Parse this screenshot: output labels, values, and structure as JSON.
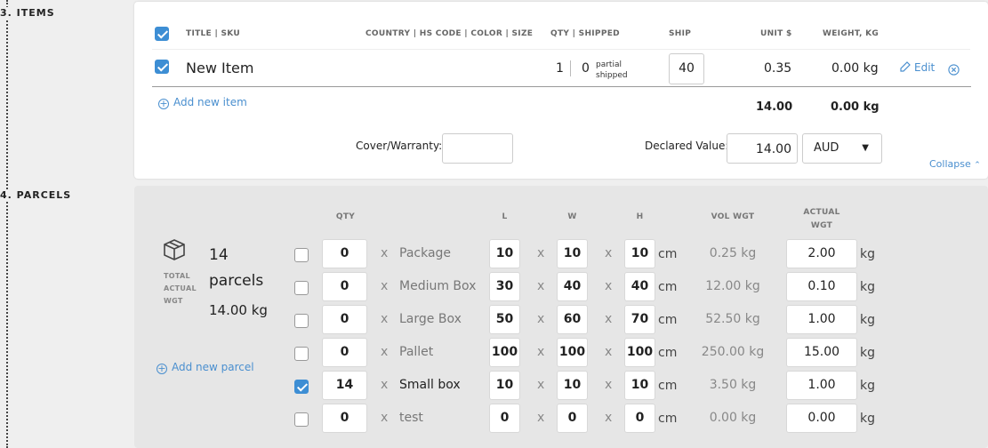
{
  "sections": {
    "items_label": "3. ITEMS",
    "parcels_label": "4. PARCELS"
  },
  "items": {
    "headers": {
      "title_sku": "TITLE | SKU",
      "country": "COUNTRY | HS CODE | COLOR | SIZE",
      "qty_shipped": "QTY |  SHIPPED",
      "ship": "SHIP",
      "unit": "UNIT $",
      "weight": "WEIGHT, KG"
    },
    "row": {
      "title": "New Item",
      "qty": "1",
      "shipped": "0",
      "status_line1": "partial",
      "status_line2": "shipped",
      "ship_value": "40",
      "unit": "0.35",
      "weight": "0.00 kg",
      "edit_label": "Edit"
    },
    "add_item_label": "Add new item",
    "totals": {
      "unit": "14.00",
      "weight": "0.00 kg"
    },
    "cover_label": "Cover/Warranty:",
    "cover_value": "",
    "declared_label": "Declared Value:",
    "declared_value": "14.00",
    "currency": "AUD",
    "collapse_label": "Collapse"
  },
  "parcels": {
    "headers": {
      "qty": "QTY",
      "l": "L",
      "w": "W",
      "h": "H",
      "vol": "VOL WGT",
      "actual_line1": "ACTUAL",
      "actual_line2": "WGT"
    },
    "summary": {
      "count": "14",
      "count_unit": "parcels",
      "total_weight": "14.00 kg",
      "label_line1": "TOTAL",
      "label_line2": "ACTUAL",
      "label_line3": "WGT"
    },
    "add_parcel_label": "Add new parcel",
    "x_symbol": "x",
    "dim_unit": "cm",
    "weight_unit": "kg",
    "rows": [
      {
        "checked": false,
        "qty": "0",
        "name": "Package",
        "l": "10",
        "w": "10",
        "h": "10",
        "vol": "0.25 kg",
        "actual": "2.00"
      },
      {
        "checked": false,
        "qty": "0",
        "name": "Medium Box",
        "l": "30",
        "w": "40",
        "h": "40",
        "vol": "12.00 kg",
        "actual": "0.10"
      },
      {
        "checked": false,
        "qty": "0",
        "name": "Large Box",
        "l": "50",
        "w": "60",
        "h": "70",
        "vol": "52.50 kg",
        "actual": "1.00"
      },
      {
        "checked": false,
        "qty": "0",
        "name": "Pallet",
        "l": "100",
        "w": "100",
        "h": "100",
        "vol": "250.00 kg",
        "actual": "15.00"
      },
      {
        "checked": true,
        "qty": "14",
        "name": "Small box",
        "l": "10",
        "w": "10",
        "h": "10",
        "vol": "3.50 kg",
        "actual": "1.00"
      },
      {
        "checked": false,
        "qty": "0",
        "name": "test",
        "l": "0",
        "w": "0",
        "h": "0",
        "vol": "0.00 kg",
        "actual": "0.00"
      }
    ]
  }
}
